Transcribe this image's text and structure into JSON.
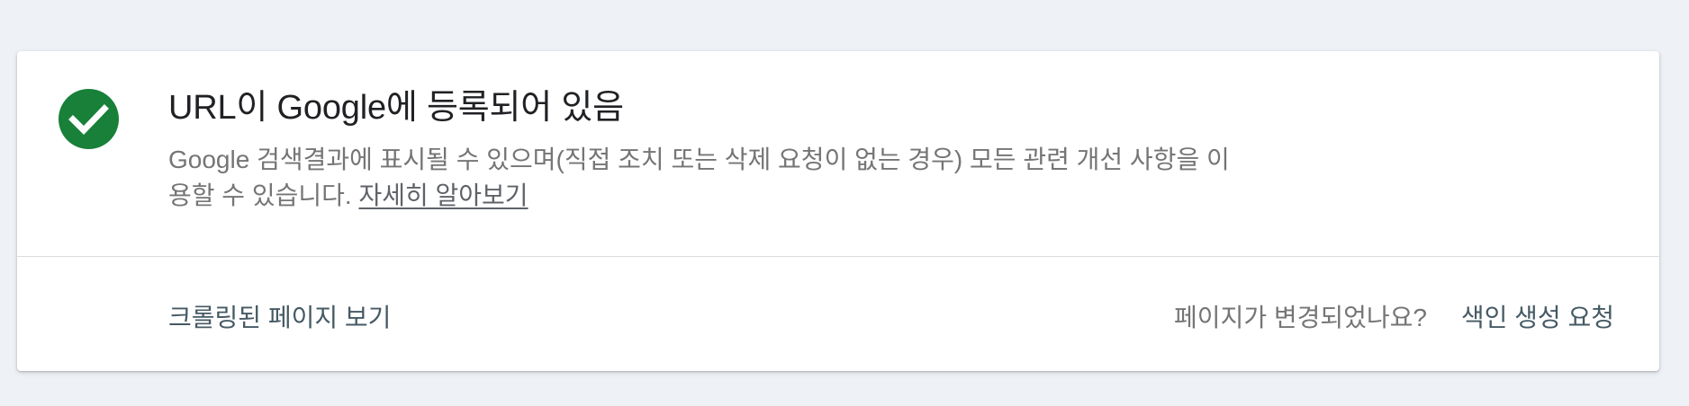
{
  "status": {
    "icon": "check-circle-icon",
    "icon_color": "#188038",
    "title": "URL이 Google에 등록되어 있음",
    "description": "Google 검색결과에 표시될 수 있으며(직접 조치 또는 삭제 요청이 없는 경우) 모든 관련 개선 사항을 이용할 수 있습니다.",
    "learn_more_label": "자세히 알아보기"
  },
  "actions": {
    "view_crawled_label": "크롤링된 페이지 보기",
    "page_changed_question": "페이지가 변경되었나요?",
    "request_indexing_label": "색인 생성 요청"
  }
}
